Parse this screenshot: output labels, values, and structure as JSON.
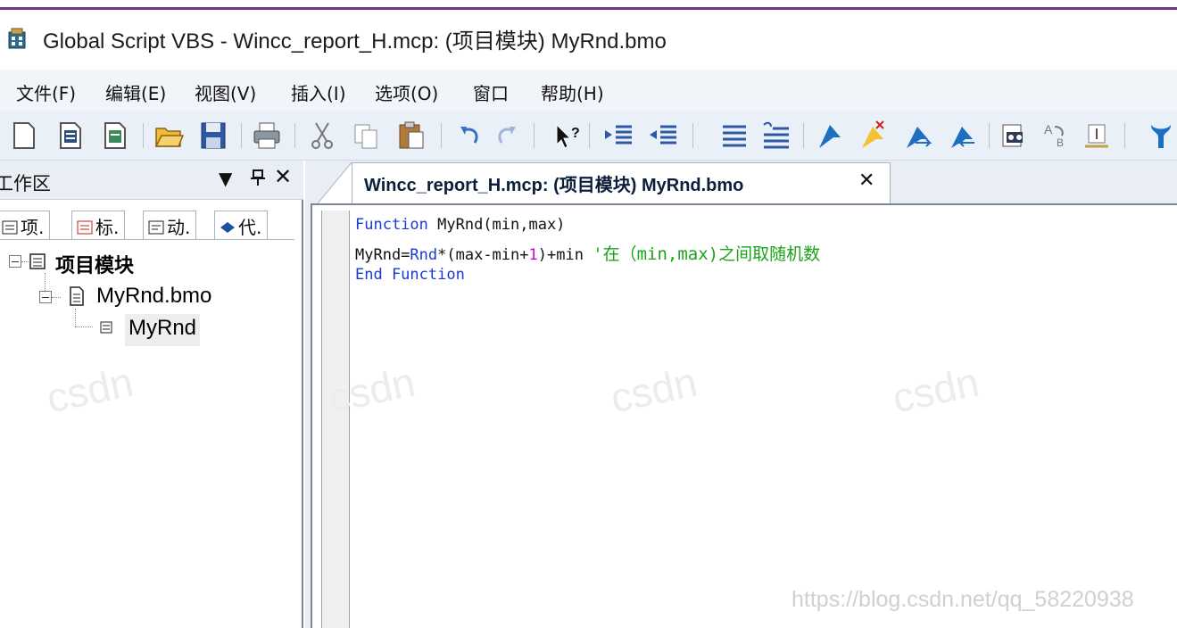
{
  "window": {
    "title": "Global Script VBS - Wincc_report_H.mcp: (项目模块) MyRnd.bmo",
    "app_icon": "global-script-icon"
  },
  "menu": {
    "items": [
      "文件(F)",
      "编辑(E)",
      "视图(V)",
      "插入(I)",
      "选项(O)",
      "窗口",
      "帮助(H)"
    ]
  },
  "toolbar": {
    "buttons": [
      "new-icon",
      "new-module-icon",
      "new-procedure-icon",
      "open-icon",
      "save-icon",
      "print-icon",
      "cut-icon",
      "copy-icon",
      "paste-icon",
      "undo-icon",
      "redo-icon",
      "help-pointer-icon",
      "indent-icon",
      "outdent-icon",
      "comment-icon",
      "uncomment-icon",
      "bookmark-icon",
      "clear-bookmark-icon",
      "next-bookmark-icon",
      "prev-bookmark-icon",
      "find-icon",
      "replace-icon",
      "goto-icon",
      "compile-icon"
    ]
  },
  "workspace": {
    "title": "工作区",
    "tabs": [
      "项.",
      "标.",
      "动.",
      "代."
    ],
    "tree": {
      "root": "项目模块",
      "file": "MyRnd.bmo",
      "procedure": "MyRnd"
    }
  },
  "editor": {
    "tab_label": "Wincc_report_H.mcp: (项目模块) MyRnd.bmo",
    "code": {
      "line1_kw": "Function",
      "line1_rest": " MyRnd(min,max)",
      "line2_a": "MyRnd=",
      "line2_b": "Rnd",
      "line2_c": "*(max-min+",
      "line2_num": "1",
      "line2_d": ")+min ",
      "line2_comment": "'在（min,max)之间取随机数",
      "line3_kw": "End Function"
    }
  },
  "watermark": {
    "url": "https://blog.csdn.net/qq_58220938",
    "mark": "csdn"
  }
}
